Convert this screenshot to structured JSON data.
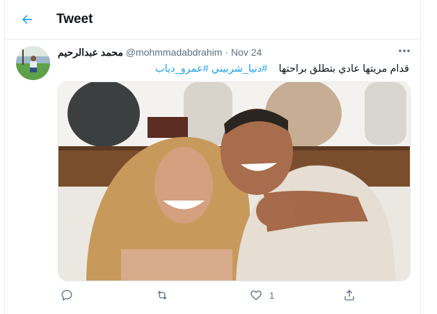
{
  "header": {
    "title": "Tweet",
    "back_icon": "arrow-left-icon",
    "accent_color": "#1da1f2"
  },
  "tweet": {
    "author_name": "محمد عبدالرحيم",
    "handle": "@mohmmadabdrahim",
    "separator": "·",
    "date": "Nov 24",
    "text": "قدام مريتها عادي بتطلق براحتها",
    "hashtags": "#دنيا_شربيني #عمرو_دياب",
    "more_icon": "more-horizontal-icon",
    "media_description": "photo-two-people"
  },
  "actions": {
    "reply_icon": "reply-icon",
    "retweet_icon": "retweet-icon",
    "like_icon": "heart-icon",
    "like_count": "1",
    "share_icon": "share-icon"
  }
}
